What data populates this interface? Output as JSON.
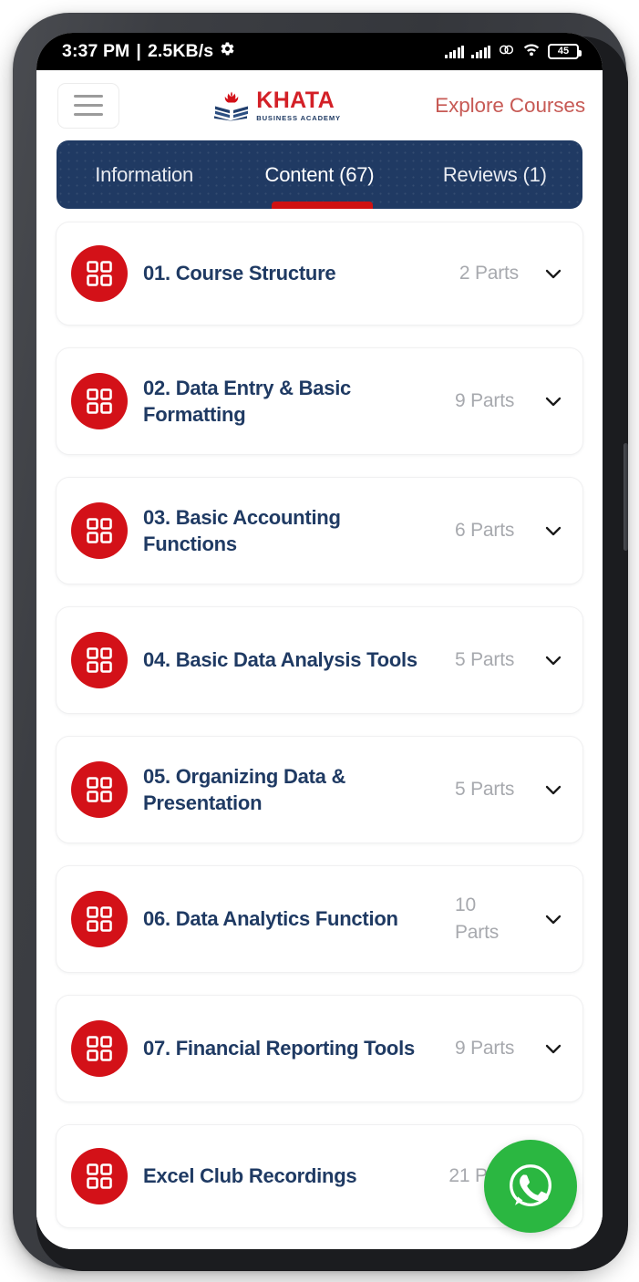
{
  "status_bar": {
    "time": "3:37 PM",
    "separator": "|",
    "network_speed": "2.5KB/s",
    "gear_icon": "gear-icon",
    "signal_icon_1": "signal-bars-icon",
    "signal_icon_2": "signal-bars-icon",
    "loop_icon": "data-saver-loop-icon",
    "wifi_icon": "wifi-icon",
    "battery_level": "45"
  },
  "header": {
    "menu_icon": "hamburger-menu-icon",
    "logo": {
      "mark_icon": "book-flame-logo-icon",
      "title": "KHATA",
      "subtitle": "BUSINESS ACADEMY"
    },
    "explore_link": "Explore Courses"
  },
  "tabs": {
    "items": [
      {
        "label": "Information",
        "active": false
      },
      {
        "label": "Content (67)",
        "active": true
      },
      {
        "label": "Reviews (1)",
        "active": false
      }
    ]
  },
  "content": {
    "sections": [
      {
        "icon": "grid-icon",
        "title": "01. Course Structure",
        "parts": "2 Parts",
        "single_line": true,
        "chevron": "chevron-down-icon"
      },
      {
        "icon": "grid-icon",
        "title": "02. Data Entry & Basic Formatting",
        "parts": "9 Parts",
        "single_line": false,
        "chevron": "chevron-down-icon"
      },
      {
        "icon": "grid-icon",
        "title": "03. Basic Accounting Functions",
        "parts": "6 Parts",
        "single_line": false,
        "chevron": "chevron-down-icon"
      },
      {
        "icon": "grid-icon",
        "title": "04. Basic Data Analysis Tools",
        "parts": "5 Parts",
        "single_line": false,
        "chevron": "chevron-down-icon"
      },
      {
        "icon": "grid-icon",
        "title": "05. Organizing Data & Presentation",
        "parts": "5 Parts",
        "single_line": false,
        "chevron": "chevron-down-icon"
      },
      {
        "icon": "grid-icon",
        "title": "06. Data Analytics Function",
        "parts": "10 Parts",
        "single_line": false,
        "chevron": "chevron-down-icon"
      },
      {
        "icon": "grid-icon",
        "title": "07. Financial Reporting Tools",
        "parts": "9 Parts",
        "single_line": false,
        "chevron": "chevron-down-icon"
      },
      {
        "icon": "grid-icon",
        "title": "Excel Club Recordings",
        "parts": "21 Parts",
        "single_line": true,
        "chevron": "chevron-down-icon"
      }
    ]
  },
  "floating_action": {
    "icon": "whatsapp-icon",
    "label": "WhatsApp"
  },
  "colors": {
    "brand_red": "#d31118",
    "navy": "#1f3a63",
    "tab_bar_navy": "#203a63",
    "accent_underline": "#cf1111",
    "explore_red": "#c75a55",
    "whatsapp_green": "#2bb741",
    "muted_gray": "#a7a9ae",
    "phone_frame": "#3c3e43"
  }
}
